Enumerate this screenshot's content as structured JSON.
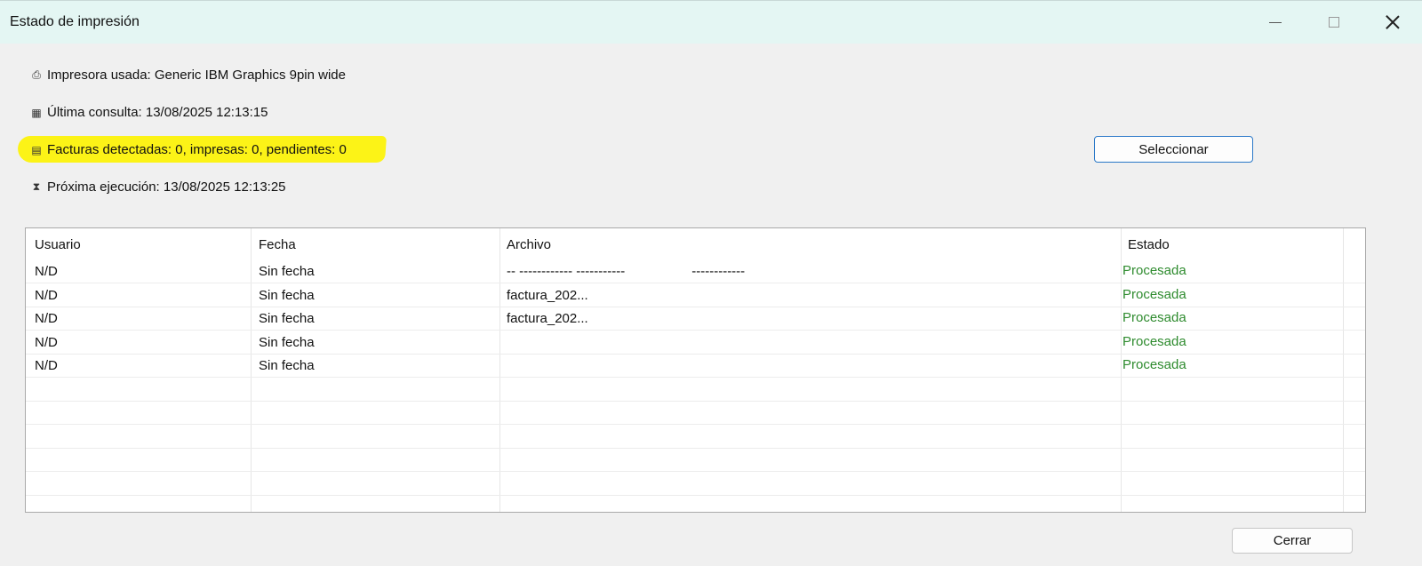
{
  "window": {
    "title": "Estado de impresión",
    "controls": [
      "minimize",
      "maximize",
      "close"
    ]
  },
  "info": {
    "printer": {
      "icon": "printer-icon",
      "text": "Impresora usada: Generic IBM Graphics 9pin wide"
    },
    "last_query": {
      "icon": "calendar-icon",
      "text": "Última consulta: 13/08/2025 12:13:15"
    },
    "invoices": {
      "icon": "document-icon",
      "text": "Facturas detectadas: 0, impresas: 0, pendientes: 0",
      "highlight_color": "#fcf317"
    },
    "next_run": {
      "icon": "hourglass-icon",
      "text": "Próxima ejecución: 13/08/2025 12:13:25"
    }
  },
  "buttons": {
    "select": "Seleccionar",
    "close": "Cerrar"
  },
  "table": {
    "columns": [
      "Usuario",
      "Fecha",
      "Archivo",
      "Estado"
    ],
    "rows": [
      {
        "usuario": "N/D",
        "fecha": "Sin fecha",
        "archivo": "-- ------------ -----------                  ------------",
        "estado": "Procesada"
      },
      {
        "usuario": "N/D",
        "fecha": "Sin fecha",
        "archivo": "factura_202...",
        "estado": "Procesada"
      },
      {
        "usuario": "N/D",
        "fecha": "Sin fecha",
        "archivo": "factura_202...",
        "estado": "Procesada"
      },
      {
        "usuario": "N/D",
        "fecha": "Sin fecha",
        "archivo": "",
        "estado": "Procesada"
      },
      {
        "usuario": "N/D",
        "fecha": "Sin fecha",
        "archivo": "",
        "estado": "Procesada"
      }
    ],
    "status_color": "#2e8b2e"
  }
}
